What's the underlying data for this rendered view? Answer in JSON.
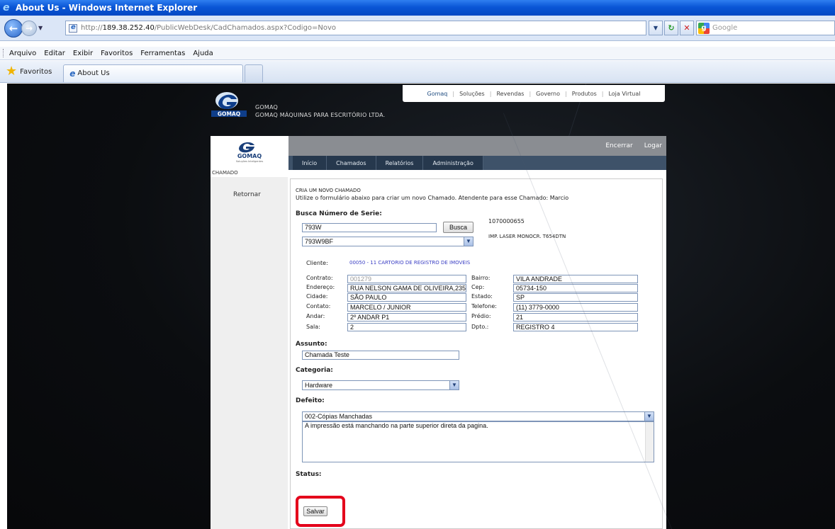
{
  "browser": {
    "window_title": "About Us - Windows Internet Explorer",
    "url_prefix": "http://",
    "url_host": "189.38.252.40",
    "url_path": "/PublicWebDesk/CadChamados.aspx?Codigo=Novo",
    "search_placeholder": "Google",
    "menu": [
      "Arquivo",
      "Editar",
      "Exibir",
      "Favoritos",
      "Ferramentas",
      "Ajuda"
    ],
    "favorites_label": "Favoritos",
    "tab_title": "About Us"
  },
  "site": {
    "name_line1": "GOMAQ",
    "name_line2": "GOMAQ MÁQUINAS PARA ESCRITÓRIO LTDA.",
    "nav": [
      "Gomaq",
      "Soluções",
      "Revendas",
      "Governo",
      "Produtos",
      "Loja Virtual"
    ]
  },
  "app": {
    "logo_text": "GOMAQ",
    "logo_tagline": "Soluções Inteligentes",
    "top_links": [
      "Encerrar",
      "Logar"
    ],
    "tabs": [
      "Início",
      "Chamados",
      "Relatórios",
      "Administração"
    ],
    "section_label": "CHAMADO",
    "sidebar_back": "Retornar"
  },
  "form": {
    "heading": "CRIA UM NOVO CHAMADO",
    "intro": "Utilize o formulário abaixo para criar um novo Chamado. Atendente para esse Chamado: Marcio",
    "serial_label": "Busca Número de Serie:",
    "serial_value": "793W",
    "search_button": "Busca",
    "serial_select": "793W9BF",
    "serial_result": "1070000655",
    "product_desc": "IMP. LASER MONOCR. T654DTN",
    "client_label": "Cliente:",
    "client_value": "00050  - 11 CARTORIO DE REGISTRO DE IMOVEIS",
    "left_fields": [
      {
        "label": "Contrato:",
        "value": "001279"
      },
      {
        "label": "Endereço:",
        "value": "RUA NELSON GAMA DE OLIVEIRA,235"
      },
      {
        "label": "Cidade:",
        "value": "SÃO PAULO"
      },
      {
        "label": "Contato:",
        "value": "MARCELO / JUNIOR"
      },
      {
        "label": "Andar:",
        "value": "2º ANDAR P1"
      },
      {
        "label": "Sala:",
        "value": "2"
      }
    ],
    "right_fields": [
      {
        "label": "Bairro:",
        "value": "VILA ANDRADE"
      },
      {
        "label": "Cep:",
        "value": "05734-150"
      },
      {
        "label": "Estado:",
        "value": "SP"
      },
      {
        "label": "Telefone:",
        "value": "(11) 3779-0000"
      },
      {
        "label": "Prédio:",
        "value": "21"
      },
      {
        "label": "Dpto.:",
        "value": "REGISTRO 4"
      }
    ],
    "subject_label": "Assunto:",
    "subject_value": "Chamada Teste",
    "category_label": "Categoria:",
    "category_value": "Hardware",
    "defect_label": "Defeito:",
    "defect_value": "002-Cópias Manchadas",
    "defect_text": "A impressão está manchando na parte superior direta da pagina.",
    "status_label": "Status:",
    "save_button": "Salvar"
  },
  "colors": {
    "highlight": "#e4001b",
    "app_tab_bar": "#3e5269",
    "client_link": "#3b3fc4"
  }
}
